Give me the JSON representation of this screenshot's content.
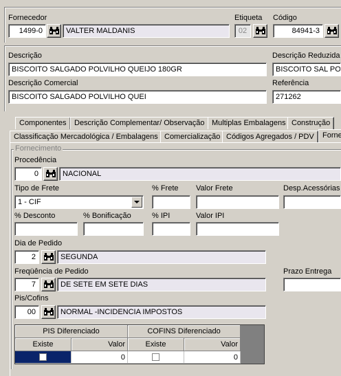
{
  "supplier": {
    "label": "Fornecedor",
    "code": "1499-0",
    "name": "VALTER MALDANIS"
  },
  "etiqueta": {
    "label": "Etiqueta",
    "value": "02"
  },
  "codigo": {
    "label": "Código",
    "value": "84941-3"
  },
  "descricao": {
    "label": "Descrição",
    "value": "BISCOITO SALGADO POLVILHO QUEIJO 180GR"
  },
  "descricao_reduzida": {
    "label": "Descrição Reduzida",
    "value": "BISCOITO SAL POL"
  },
  "descricao_comercial": {
    "label": "Descrição Comercial",
    "value": "BISCOITO SALGADO POLVILHO QUEI"
  },
  "referencia": {
    "label": "Referência",
    "value": "271262"
  },
  "tabs_row1": [
    "Componentes",
    "Descrição Complementar/ Observação",
    "Multiplas Embalagens",
    "Construção"
  ],
  "tabs_row2": [
    "Classificação Mercadológica / Embalagens",
    "Comercialização",
    "Códigos Agregados / PDV",
    "Forne"
  ],
  "fornecimento": {
    "title": "Fornecimento",
    "procedencia": {
      "label": "Procedência",
      "code": "0",
      "name": "NACIONAL"
    },
    "tipo_frete": {
      "label": "Tipo de Frete",
      "value": "1 - CIF"
    },
    "pct_frete": {
      "label": "% Frete",
      "value": ""
    },
    "valor_frete": {
      "label": "Valor Frete",
      "value": ""
    },
    "desp_acessorias": {
      "label": "Desp.Acessórias",
      "value": ""
    },
    "pct_desconto": {
      "label": "% Desconto",
      "value": ""
    },
    "pct_bonificacao": {
      "label": "% Bonificação",
      "value": ""
    },
    "pct_ipi": {
      "label": "% IPI",
      "value": ""
    },
    "valor_ipi": {
      "label": "Valor IPI",
      "value": ""
    },
    "dia_pedido": {
      "label": "Dia de Pedido",
      "code": "2",
      "name": "SEGUNDA"
    },
    "frequencia_pedido": {
      "label": "Freqüência de Pedido",
      "code": "7",
      "name": "DE SETE EM SETE DIAS"
    },
    "prazo_entrega": {
      "label": "Prazo Entrega",
      "value": ""
    },
    "pis_cofins": {
      "label": "Pis/Cofins",
      "code": "00",
      "name": "NORMAL -INCIDENCIA IMPOSTOS"
    }
  },
  "grid": {
    "group_pis": "PIS Diferenciado",
    "group_cofins": "COFINS Diferenciado",
    "col_existe": "Existe",
    "col_valor": "Valor",
    "pis_valor": "0",
    "cofins_valor": "0"
  },
  "colors": {
    "selected_cell": "#0a246a",
    "readonly_bg": "#e9e6ee"
  }
}
